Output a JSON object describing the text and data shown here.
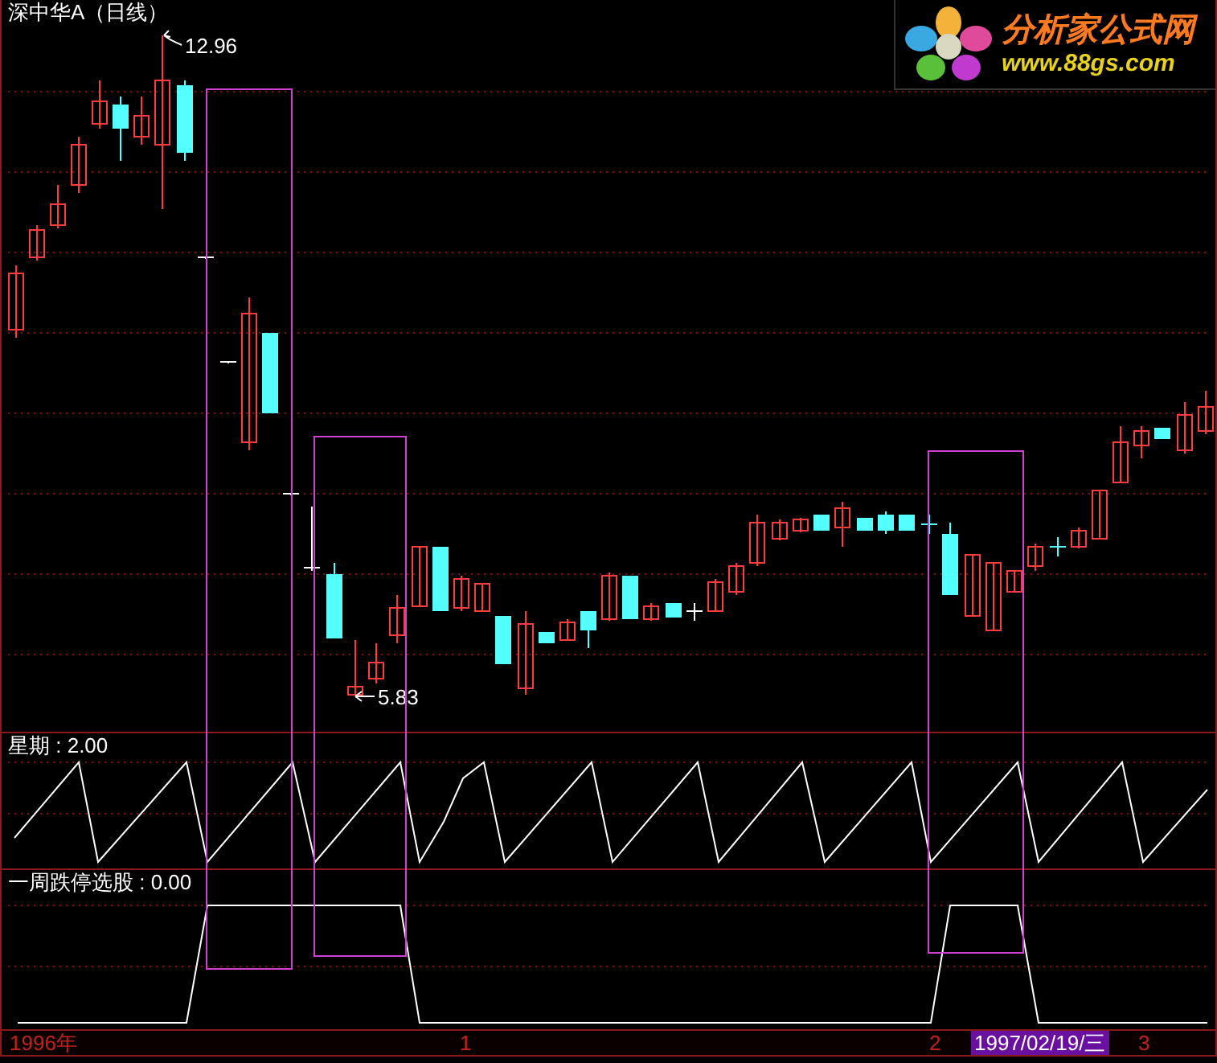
{
  "stock": {
    "title": "深中华A（日线）",
    "high_label": "12.96",
    "low_label": "5.83"
  },
  "indicators": [
    {
      "label": "星期 : 2.00"
    },
    {
      "label": "一周跌停选股 : 0.00"
    }
  ],
  "axis": {
    "labels": [
      {
        "text": "1996年",
        "selected": false
      },
      {
        "text": "1",
        "selected": false
      },
      {
        "text": "2",
        "selected": false
      },
      {
        "text": "1997/02/19/三",
        "selected": true
      },
      {
        "text": "3",
        "selected": false
      }
    ]
  },
  "logo": {
    "name": "分析家公式网",
    "url": "www.88gs.com"
  }
}
